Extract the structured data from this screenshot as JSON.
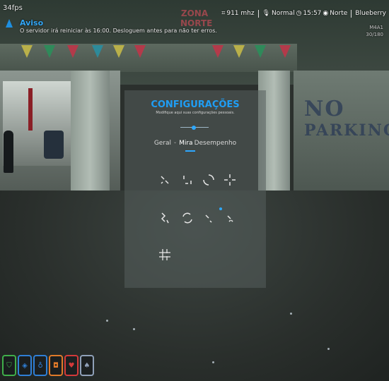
{
  "hud": {
    "fps": "34fps",
    "notification": {
      "icon": "warning-icon",
      "title": "Aviso",
      "message": "O servidor irá reiniciar às 16:00. Desloguem antes para não ter erros."
    },
    "status": {
      "radio": "911 mhz",
      "voice": "Normal",
      "time": "15:57",
      "direction": "Norte",
      "location": "Blueberry"
    },
    "coords": {
      "line1": "M4A1",
      "line2": "30/180"
    }
  },
  "settings": {
    "title": "CONFIGURAÇÕES",
    "subtitle": "Modifique aqui suas configurações pessoais.",
    "tabs": [
      {
        "label": "Geral"
      },
      {
        "label": "Mira"
      },
      {
        "label": "Desempenho"
      }
    ],
    "active_tab": "Mira"
  },
  "scene": {
    "sign_line1": "NO",
    "sign_line2": "PARKING",
    "logo": "ZONA NORTE"
  },
  "hotbar": [
    {
      "icon": "shield-icon",
      "color": "#3fae4a"
    },
    {
      "icon": "drop-icon",
      "color": "#2f7fd6"
    },
    {
      "icon": "bottle-icon",
      "color": "#2f7fd6"
    },
    {
      "icon": "food-icon",
      "color": "#e07a2a"
    },
    {
      "icon": "heart-icon",
      "color": "#d43a3a"
    },
    {
      "icon": "lungs-icon",
      "color": "#8fa0b8"
    }
  ],
  "colors": {
    "accent": "#1f9ef5",
    "panel": "#565e5c"
  }
}
